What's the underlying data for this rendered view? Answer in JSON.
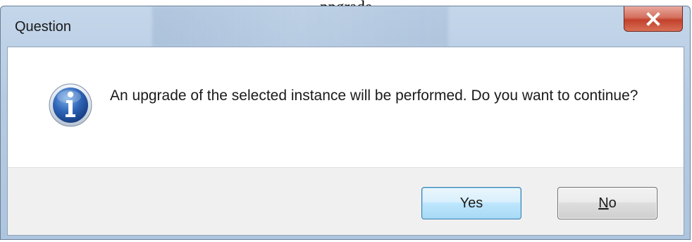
{
  "page": {
    "caption": "ppgrade"
  },
  "dialog": {
    "title": "Question",
    "close_label": "x",
    "message": "An upgrade of the selected instance will be performed. Do you want to continue?",
    "icon": "information-icon"
  },
  "buttons": {
    "yes_label": "Yes",
    "no_mnemonic": "N",
    "no_rest": "o"
  },
  "colors": {
    "titlebar": "#b6cbe2",
    "close_button": "#c2412c",
    "default_button_border": "#3c7fb1",
    "info_icon": "#2a5caa"
  }
}
